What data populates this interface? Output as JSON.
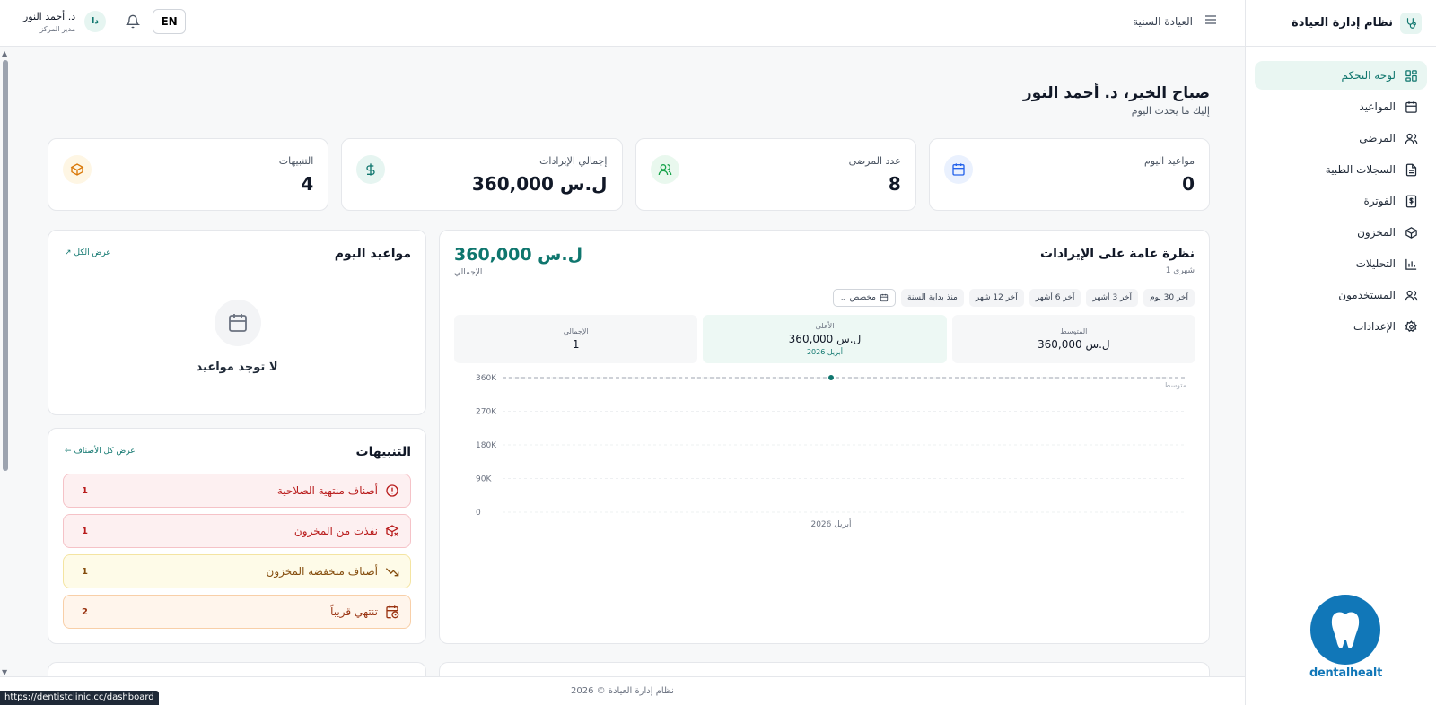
{
  "app": {
    "title": "نظام إدارة العيادة"
  },
  "sidebar": {
    "items": [
      {
        "label": "لوحة التحكم",
        "icon": "dashboard-icon"
      },
      {
        "label": "المواعيد",
        "icon": "calendar-icon"
      },
      {
        "label": "المرضى",
        "icon": "users-icon"
      },
      {
        "label": "السجلات الطبية",
        "icon": "document-icon"
      },
      {
        "label": "الفوترة",
        "icon": "billing-icon"
      },
      {
        "label": "المخزون",
        "icon": "box-icon"
      },
      {
        "label": "التحليلات",
        "icon": "chart-icon"
      },
      {
        "label": "المستخدمون",
        "icon": "users-icon"
      },
      {
        "label": "الإعدادات",
        "icon": "gear-icon"
      }
    ],
    "logo_text": "dentalhealt"
  },
  "topbar": {
    "clinic_name": "العيادة السنية",
    "user_name": "د. أحمد النور",
    "user_role": "مدير المركز",
    "avatar_initials": "دا",
    "language": "EN"
  },
  "greeting": {
    "title": "صباح الخير، د. أحمد النور",
    "subtitle": "إليك ما يحدث اليوم"
  },
  "stats": [
    {
      "label": "مواعيد اليوم",
      "value": "0",
      "icon": "calendar-icon",
      "color": "#2563eb"
    },
    {
      "label": "عدد المرضى",
      "value": "8",
      "icon": "users-icon",
      "color": "#16a34a"
    },
    {
      "label": "إجمالي الإيرادات",
      "value": "360,000 ل.س",
      "icon": "dollar-icon",
      "color": "#0f766e"
    },
    {
      "label": "التنبيهات",
      "value": "4",
      "icon": "box-icon",
      "color": "#d97706"
    }
  ],
  "revenue": {
    "title": "نظرة عامة على الإيرادات",
    "subtitle": "1 شهري",
    "total": "360,000 ل.س",
    "total_label": "الإجمالي",
    "ranges": [
      "آخر 30 يوم",
      "آخر 3 أشهر",
      "آخر 6 أشهر",
      "آخر 12 شهر",
      "منذ بداية السنة",
      "مخصص"
    ],
    "metrics": [
      {
        "label": "المتوسط",
        "value": "360,000 ل.س",
        "sub": ""
      },
      {
        "label": "الأعلى",
        "value": "360,000 ل.س",
        "sub": "أبريل 2026"
      },
      {
        "label": "الإجمالي",
        "value": "1",
        "sub": ""
      }
    ]
  },
  "chart_data": {
    "type": "line",
    "x": [
      "أبريل 2026"
    ],
    "series": [
      {
        "values": [
          360000
        ]
      }
    ],
    "yticks": [
      "360K",
      "270K",
      "180K",
      "90K",
      "0"
    ],
    "ylim": [
      0,
      360000
    ],
    "reference_label": "متوسط",
    "reference_value": 360000,
    "grid": true
  },
  "appointments": {
    "title": "مواعيد اليوم",
    "view_all": "عرض الكل",
    "empty": "لا توجد مواعيد"
  },
  "alerts": {
    "title": "التنبيهات",
    "view_all": "عرض كل الأصناف",
    "items": [
      {
        "label": "أصناف منتهية الصلاحية",
        "count": "1",
        "icon": "alert-circle-icon"
      },
      {
        "label": "نفذت من المخزون",
        "count": "1",
        "icon": "box-x-icon"
      },
      {
        "label": "أصناف منخفضة المخزون",
        "count": "1",
        "icon": "trend-down-icon"
      },
      {
        "label": "تنتهي قريباً",
        "count": "2",
        "icon": "calendar-clock-icon"
      }
    ]
  },
  "footer": {
    "text": "نظام إدارة العيادة © 2026"
  },
  "status_url": "https://dentistclinic.cc/dashboard"
}
